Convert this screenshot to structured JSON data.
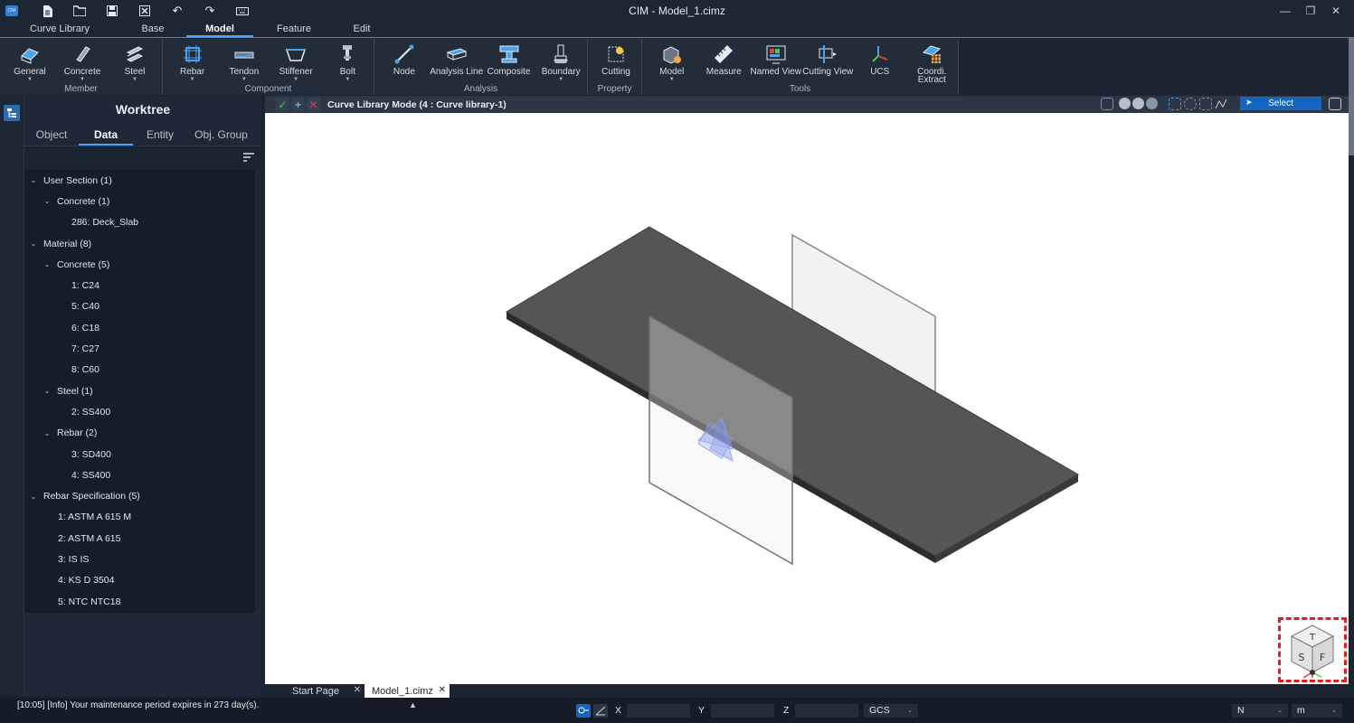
{
  "window": {
    "title": "CIM - Model_1.cimz",
    "app_logo_text": "CIM",
    "controls": [
      "—",
      "❐",
      "✕"
    ]
  },
  "quick_access": [
    "new",
    "open",
    "save",
    "close",
    "undo",
    "redo",
    "keyboard"
  ],
  "ribbon_tabs": [
    "Curve Library",
    "Base",
    "Model",
    "Feature",
    "Edit"
  ],
  "active_ribbon_tab": "Model",
  "ribbon_groups": {
    "member": {
      "name": "Member",
      "buttons": [
        "General",
        "Concrete",
        "Steel"
      ]
    },
    "component": {
      "name": "Component",
      "buttons": [
        "Rebar",
        "Tendon",
        "Stiffener",
        "Bolt"
      ]
    },
    "analysis": {
      "name": "Analysis",
      "buttons": [
        "Node",
        "Analysis Line",
        "Composite",
        "Boundary"
      ]
    },
    "property": {
      "name": "Property",
      "buttons": [
        "Cutting"
      ]
    },
    "tools": {
      "name": "Tools",
      "buttons": [
        "Model",
        "Measure",
        "Named View",
        "Cutting View",
        "UCS",
        "Coordi. Extract"
      ]
    }
  },
  "worktree": {
    "title": "Worktree",
    "tabs": [
      "Object",
      "Data",
      "Entity",
      "Obj. Group"
    ],
    "active_tab": "Data",
    "nodes": [
      {
        "label": "User Section (1)",
        "level": "lvl0",
        "expanded": true
      },
      {
        "label": "Concrete (1)",
        "level": "lvl1",
        "expanded": true
      },
      {
        "label": "286: Deck_Slab",
        "level": "lvl2",
        "expanded": null
      },
      {
        "label": "Material (8)",
        "level": "lvl0",
        "expanded": true
      },
      {
        "label": "Concrete (5)",
        "level": "lvl1",
        "expanded": true
      },
      {
        "label": "1: C24",
        "level": "lvl2",
        "expanded": null
      },
      {
        "label": "5: C40",
        "level": "lvl2",
        "expanded": null
      },
      {
        "label": "6: C18",
        "level": "lvl2",
        "expanded": null
      },
      {
        "label": "7: C27",
        "level": "lvl2",
        "expanded": null
      },
      {
        "label": "8: C60",
        "level": "lvl2",
        "expanded": null
      },
      {
        "label": "Steel (1)",
        "level": "lvl1",
        "expanded": true
      },
      {
        "label": "2: SS400",
        "level": "lvl2",
        "expanded": null
      },
      {
        "label": "Rebar (2)",
        "level": "lvl1",
        "expanded": true
      },
      {
        "label": "3: SD400",
        "level": "lvl2",
        "expanded": null
      },
      {
        "label": "4: SS400",
        "level": "lvl2",
        "expanded": null
      },
      {
        "label": "Rebar Specification (5)",
        "level": "lvl0",
        "expanded": true
      },
      {
        "label": "1: ASTM A 615 M",
        "level": "lvl2r",
        "expanded": null
      },
      {
        "label": "2: ASTM A 615",
        "level": "lvl2r",
        "expanded": null
      },
      {
        "label": "3: IS IS",
        "level": "lvl2r",
        "expanded": null
      },
      {
        "label": "4: KS D 3504",
        "level": "lvl2r",
        "expanded": null
      },
      {
        "label": "5: NTC NTC18",
        "level": "lvl2r",
        "expanded": null
      }
    ]
  },
  "viewport": {
    "mode_text": "Curve Library Mode (4 : Curve library-1)",
    "select_label": "Select",
    "view_cube_labels": [
      "T",
      "S",
      "F"
    ]
  },
  "doc_tabs": [
    {
      "label": "Start Page",
      "active": false
    },
    {
      "label": "Model_1.cimz",
      "active": true
    }
  ],
  "status": {
    "message": "[10:05] [Info] Your maintenance period expires in 273 day(s).",
    "x_label": "X",
    "y_label": "Y",
    "z_label": "Z",
    "coord_system": "GCS",
    "force_unit": "N",
    "length_unit": "m"
  },
  "colors": {
    "accent": "#1565c0",
    "check": "#4fc84f",
    "cancel": "#e04040",
    "highlight_box": "#e01e1e"
  }
}
